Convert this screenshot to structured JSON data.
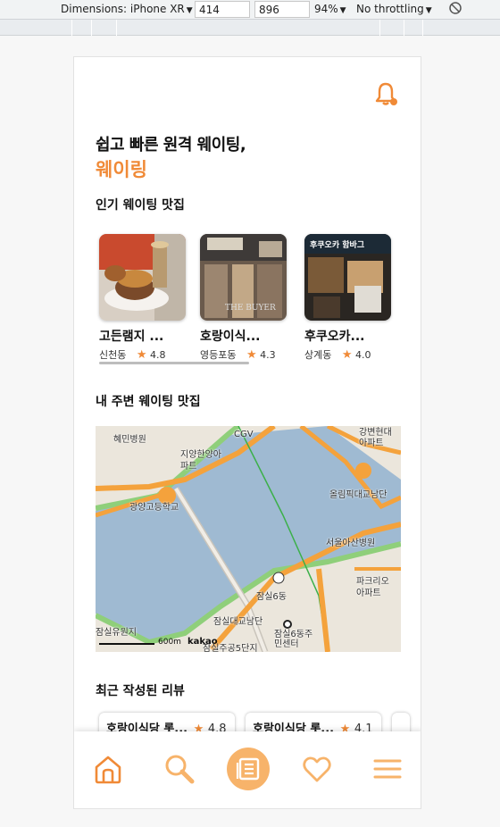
{
  "devtools": {
    "dimensions_label": "Dimensions: iPhone XR",
    "width": "414",
    "times": "×",
    "height": "896",
    "zoom": "94%",
    "throttle": "No throttling"
  },
  "app": {
    "headline_line1": "쉽고 빠른 원격 웨이팅,",
    "brand": "웨이링",
    "popular_title": "인기 웨이팅 맛집",
    "nearby_title": "내 주변 웨이팅 맛집",
    "recent_title": "최근 작성된 리뷰"
  },
  "restaurants": [
    {
      "name": "고든램지 ...",
      "area": "신천동",
      "rating": "4.8"
    },
    {
      "name": "호랑이식...",
      "area": "영등포동",
      "rating": "4.3"
    },
    {
      "name": "후쿠오카...",
      "area": "상계동",
      "rating": "4.0"
    }
  ],
  "shop_sign": "후쿠오카 함바그",
  "watermark": "THE BUYER",
  "reviews": [
    {
      "name": "호랑이식당 롯...",
      "rating": "4.8"
    },
    {
      "name": "호랑이식당 롯...",
      "rating": "4.1"
    }
  ],
  "map": {
    "labels": [
      "혜민병원",
      "CGV",
      "강변현대아파트",
      "지양한양아파트",
      "광양고등학교",
      "올림픽대교남단",
      "서울아산병원",
      "잠실6동",
      "파크리오아파트",
      "잠실대교남단",
      "잠실6동주민센터",
      "잠실유원지",
      "잠실주공5단지"
    ],
    "scale": "600m",
    "logo": "kakao",
    "water_color": "#9fbad2",
    "road_color": "#f4a23c"
  },
  "nav": {
    "items": [
      "home-icon",
      "search-icon",
      "list-icon",
      "heart-icon",
      "menu-icon"
    ],
    "accent": "#f08a37"
  }
}
